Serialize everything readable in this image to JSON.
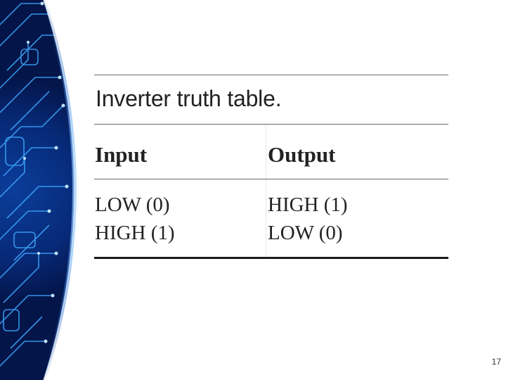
{
  "table": {
    "caption": "Inverter truth table.",
    "headers": [
      "Input",
      "Output"
    ],
    "rows": [
      [
        "LOW (0)",
        "HIGH (1)"
      ],
      [
        "HIGH (1)",
        "LOW (0)"
      ]
    ]
  },
  "page_number": "17",
  "colors": {
    "background": "#ffffff",
    "decoration_dark_blue": "#061a4a",
    "decoration_glow": "#3fa9ff",
    "text": "#222222"
  }
}
